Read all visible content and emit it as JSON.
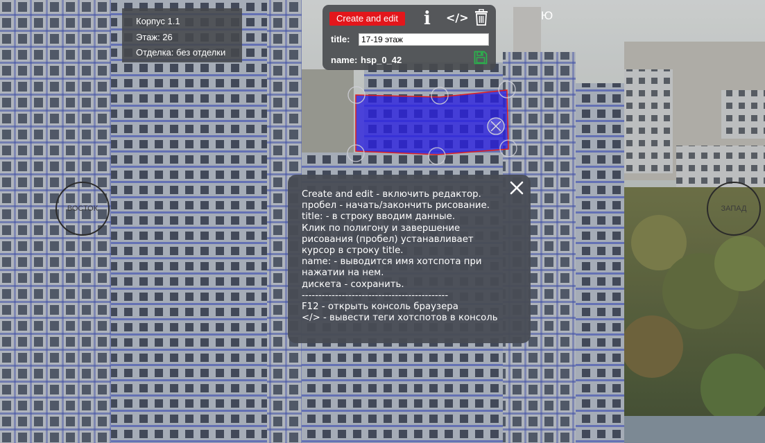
{
  "info": {
    "building": "Корпус 1.1",
    "floor": "Этаж: 26",
    "finish": "Отделка: без отделки"
  },
  "editor": {
    "create_edit_label": "Create and edit",
    "info_icon": "i",
    "code_icon": "</>",
    "trash_icon": "trash-icon",
    "title_label": "title:",
    "title_value": "17-19 этаж",
    "name_label": "name:",
    "name_value": "hsp_0_42",
    "save_icon": "floppy-disk-icon",
    "save_color": "#27a745"
  },
  "compass": {
    "south": "Ю",
    "east": "ВОСТОК",
    "west": "ЗАПАД"
  },
  "hotspot": {
    "fill_color": "#2a1fe0",
    "stroke_color": "#e02020"
  },
  "help": {
    "lines": [
      "Create and edit - включить редактор.",
      "пробел - начать/закончить рисование.",
      "title: - в строку вводим данные.",
      "Клик по полигону и завершение",
      "рисования (пробел) устанавливает",
      "курсор в строку title.",
      "name: - выводится имя хотспота при",
      "нажатии на нем.",
      "дискета - сохранить.",
      "--------------------------------------------",
      "F12 - открыть консоль браузера",
      "</> - вывести теги хотспотов в консоль"
    ]
  }
}
